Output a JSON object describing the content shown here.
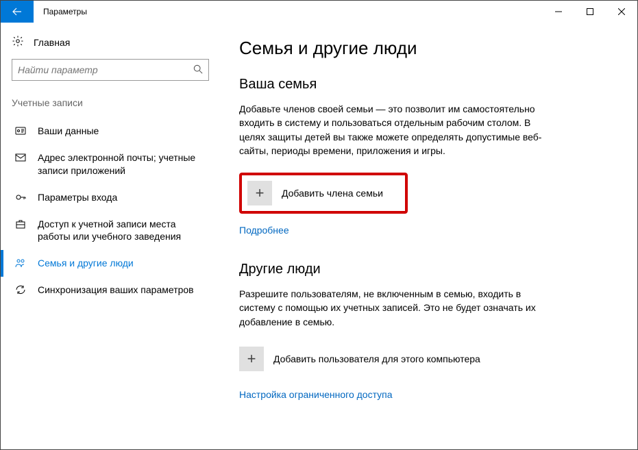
{
  "window": {
    "title": "Параметры"
  },
  "sidebar": {
    "home_label": "Главная",
    "search_placeholder": "Найти параметр",
    "group_label": "Учетные записи",
    "items": [
      {
        "label": "Ваши данные"
      },
      {
        "label": "Адрес электронной почты; учетные записи приложений"
      },
      {
        "label": "Параметры входа"
      },
      {
        "label": "Доступ к учетной записи места работы или учебного заведения"
      },
      {
        "label": "Семья и другие люди"
      },
      {
        "label": "Синхронизация ваших параметров"
      }
    ]
  },
  "content": {
    "page_title": "Семья и другие люди",
    "family": {
      "heading": "Ваша семья",
      "desc": "Добавьте членов своей семьи — это позволит им самостоятельно входить в систему и пользоваться отдельным рабочим столом. В целях защиты детей вы также можете определять допустимые веб-сайты, периоды времени, приложения и игры.",
      "add_label": "Добавить члена семьи",
      "more_link": "Подробнее"
    },
    "others": {
      "heading": "Другие люди",
      "desc": "Разрешите пользователям, не включенным в семью, входить в систему с помощью их учетных записей. Это не будет означать их добавление в семью.",
      "add_label": "Добавить пользователя для этого компьютера",
      "restricted_link": "Настройка ограниченного доступа"
    }
  }
}
